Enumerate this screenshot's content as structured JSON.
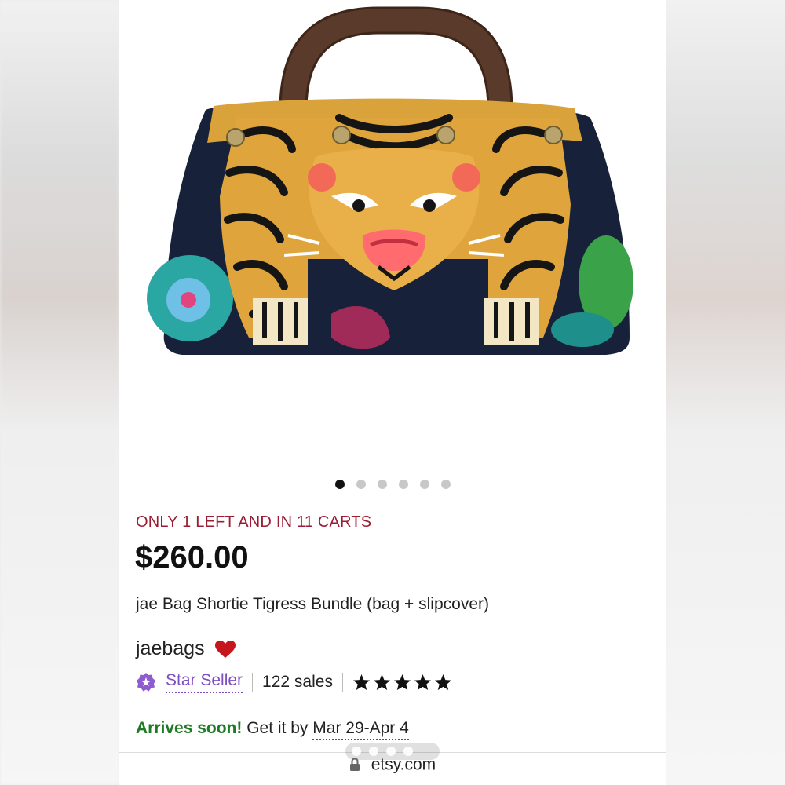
{
  "carousel": {
    "total": 6,
    "active_index": 0
  },
  "listing": {
    "scarcity_text": "ONLY 1 LEFT AND IN 11 CARTS",
    "price": "$260.00",
    "title": "jae Bag Shortie Tigress Bundle (bag + slipcover)"
  },
  "shop": {
    "name": "jaebags",
    "favorite_icon": "heart-icon",
    "badge_label": "Star Seller",
    "sales": "122 sales",
    "rating_stars": 5
  },
  "delivery": {
    "arrives_label": "Arrives soon!",
    "get_it_by": "Get it by",
    "date_range": "Mar 29-Apr 4"
  },
  "browser": {
    "url": "etsy.com",
    "lock_icon": "lock-icon"
  },
  "colors": {
    "scarcity": "#9b1c35",
    "star_seller": "#7d4ec0",
    "arrives": "#1f7a25",
    "heart": "#c4161c"
  }
}
